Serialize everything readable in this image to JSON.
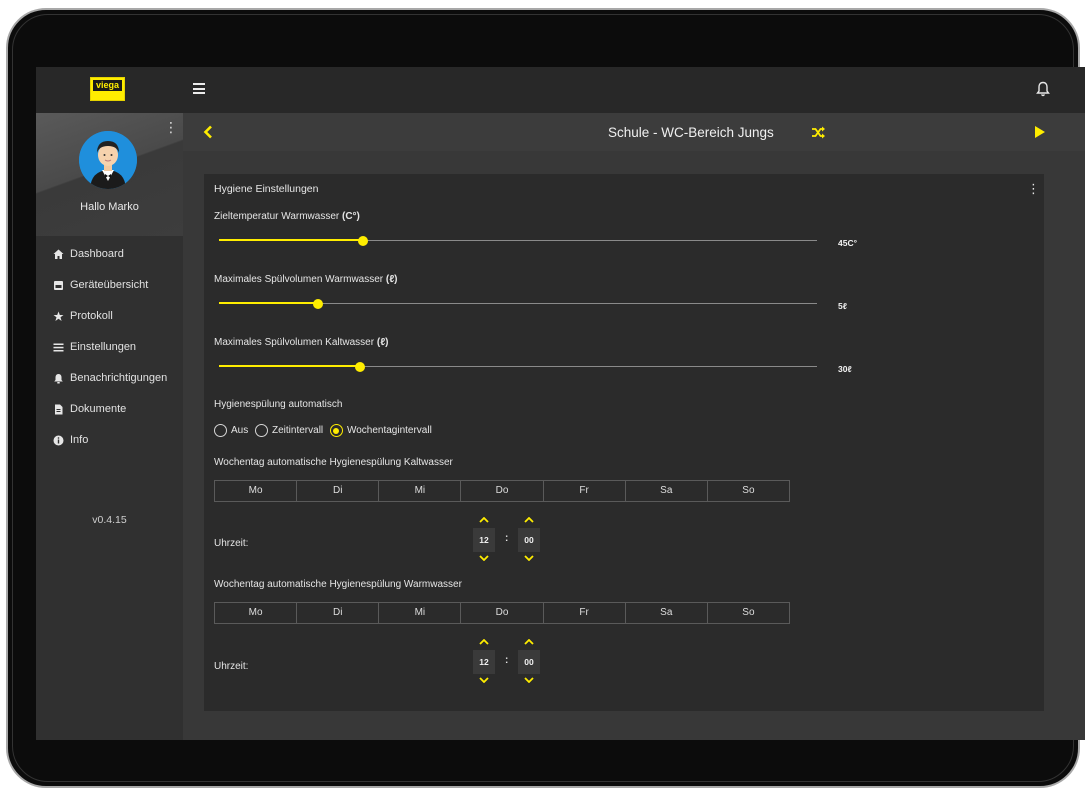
{
  "app": {
    "logo_text": "viega",
    "accent": "#ffed00"
  },
  "header": {
    "title": "Schule - WC-Bereich Jungs"
  },
  "sidebar": {
    "greeting": "Hallo Marko",
    "items": [
      {
        "label": "Dashboard",
        "icon": "home-icon"
      },
      {
        "label": "Geräteübersicht",
        "icon": "devices-icon"
      },
      {
        "label": "Protokoll",
        "icon": "star-icon"
      },
      {
        "label": "Einstellungen",
        "icon": "sliders-icon"
      },
      {
        "label": "Benachrichtigungen",
        "icon": "bell-icon"
      },
      {
        "label": "Dokumente",
        "icon": "document-icon"
      },
      {
        "label": "Info",
        "icon": "info-icon"
      }
    ],
    "version": "v0.4.15"
  },
  "card": {
    "title": "Hygiene Einstellungen",
    "sliders": [
      {
        "label": "Zieltemperatur Warmwasser",
        "unit_label": "(C°)",
        "value_text": "45C°",
        "fraction": 0.24
      },
      {
        "label": "Maximales Spülvolumen Warmwasser",
        "unit_label": "(ℓ)",
        "value_text": "5ℓ",
        "fraction": 0.165
      },
      {
        "label": "Maximales Spülvolumen Kaltwasser",
        "unit_label": "(ℓ)",
        "value_text": "30ℓ",
        "fraction": 0.236
      }
    ],
    "auto_flush": {
      "label": "Hygienespülung automatisch",
      "options": [
        "Aus",
        "Zeitintervall",
        "Wochentagintervall"
      ],
      "selected": "Wochentagintervall"
    },
    "cold": {
      "label": "Wochentag automatische Hygienespülung Kaltwasser",
      "days": [
        "Mo",
        "Di",
        "Mi",
        "Do",
        "Fr",
        "Sa",
        "So"
      ],
      "time_label": "Uhrzeit:",
      "hour": "12",
      "minute": "00",
      "separator": ":"
    },
    "warm": {
      "label": "Wochentag automatische Hygienespülung Warmwasser",
      "days": [
        "Mo",
        "Di",
        "Mi",
        "Do",
        "Fr",
        "Sa",
        "So"
      ],
      "time_label": "Uhrzeit:",
      "hour": "12",
      "minute": "00",
      "separator": ":"
    }
  }
}
